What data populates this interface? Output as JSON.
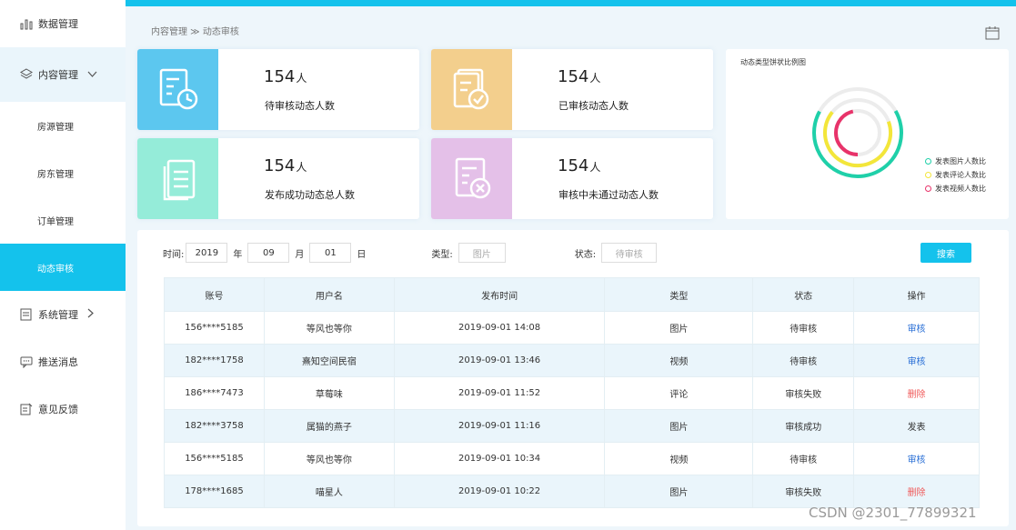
{
  "colors": {
    "accent": "#14c2ec",
    "tile_blue": "#5cc7ef",
    "tile_orange": "#f3cf8d",
    "tile_teal": "#95ecd9",
    "tile_purple": "#e4c0e8"
  },
  "sidebar": {
    "items": [
      {
        "label": "数据管理",
        "icon": "bar-chart-icon"
      },
      {
        "label": "内容管理",
        "icon": "layers-icon",
        "expanded": true
      },
      {
        "label": "房源管理"
      },
      {
        "label": "房东管理"
      },
      {
        "label": "订单管理"
      },
      {
        "label": "动态审核",
        "active": true
      },
      {
        "label": "系统管理",
        "icon": "list-icon"
      },
      {
        "label": "推送消息",
        "icon": "message-icon"
      },
      {
        "label": "意见反馈",
        "icon": "edit-icon"
      }
    ]
  },
  "breadcrumb": "内容管理 ≫ 动态审核",
  "stats": [
    {
      "value": "154",
      "unit": "人",
      "label": "待审核动态人数"
    },
    {
      "value": "154",
      "unit": "人",
      "label": "已审核动态人数"
    },
    {
      "value": "154",
      "unit": "人",
      "label": "发布成功动态总人数"
    },
    {
      "value": "154",
      "unit": "人",
      "label": "审核中未通过动态人数"
    }
  ],
  "pie": {
    "title": "动态类型饼状比例图",
    "legend": [
      {
        "label": "发表图片人数比",
        "color": "#1fd0a9"
      },
      {
        "label": "发表评论人数比",
        "color": "#f3e63a"
      },
      {
        "label": "发表视频人数比",
        "color": "#e8336a"
      }
    ]
  },
  "filters": {
    "time_label": "时间:",
    "year": "2019",
    "year_unit": "年",
    "month": "09",
    "month_unit": "月",
    "day": "01",
    "day_unit": "日",
    "type_label": "类型:",
    "type_placeholder": "图片",
    "status_label": "状态:",
    "status_placeholder": "待审核",
    "search": "搜索"
  },
  "table": {
    "headers": [
      "账号",
      "用户名",
      "发布时间",
      "类型",
      "状态",
      "操作"
    ],
    "rows": [
      [
        "156****5185",
        "等风也等你",
        "2019-09-01  14:08",
        "图片",
        "待审核",
        "审核"
      ],
      [
        "182****1758",
        "熹知空间民宿",
        "2019-09-01  13:46",
        "视频",
        "待审核",
        "审核"
      ],
      [
        "186****7473",
        "草莓味",
        "2019-09-01  11:52",
        "评论",
        "审核失败",
        "删除"
      ],
      [
        "182****3758",
        "属猫的燕子",
        "2019-09-01  11:16",
        "图片",
        "审核成功",
        "发表"
      ],
      [
        "156****5185",
        "等风也等你",
        "2019-09-01  10:34",
        "视频",
        "待审核",
        "审核"
      ],
      [
        "178****1685",
        "喵星人",
        "2019-09-01  10:22",
        "图片",
        "审核失败",
        "删除"
      ]
    ]
  },
  "watermark": "CSDN @2301_77899321"
}
